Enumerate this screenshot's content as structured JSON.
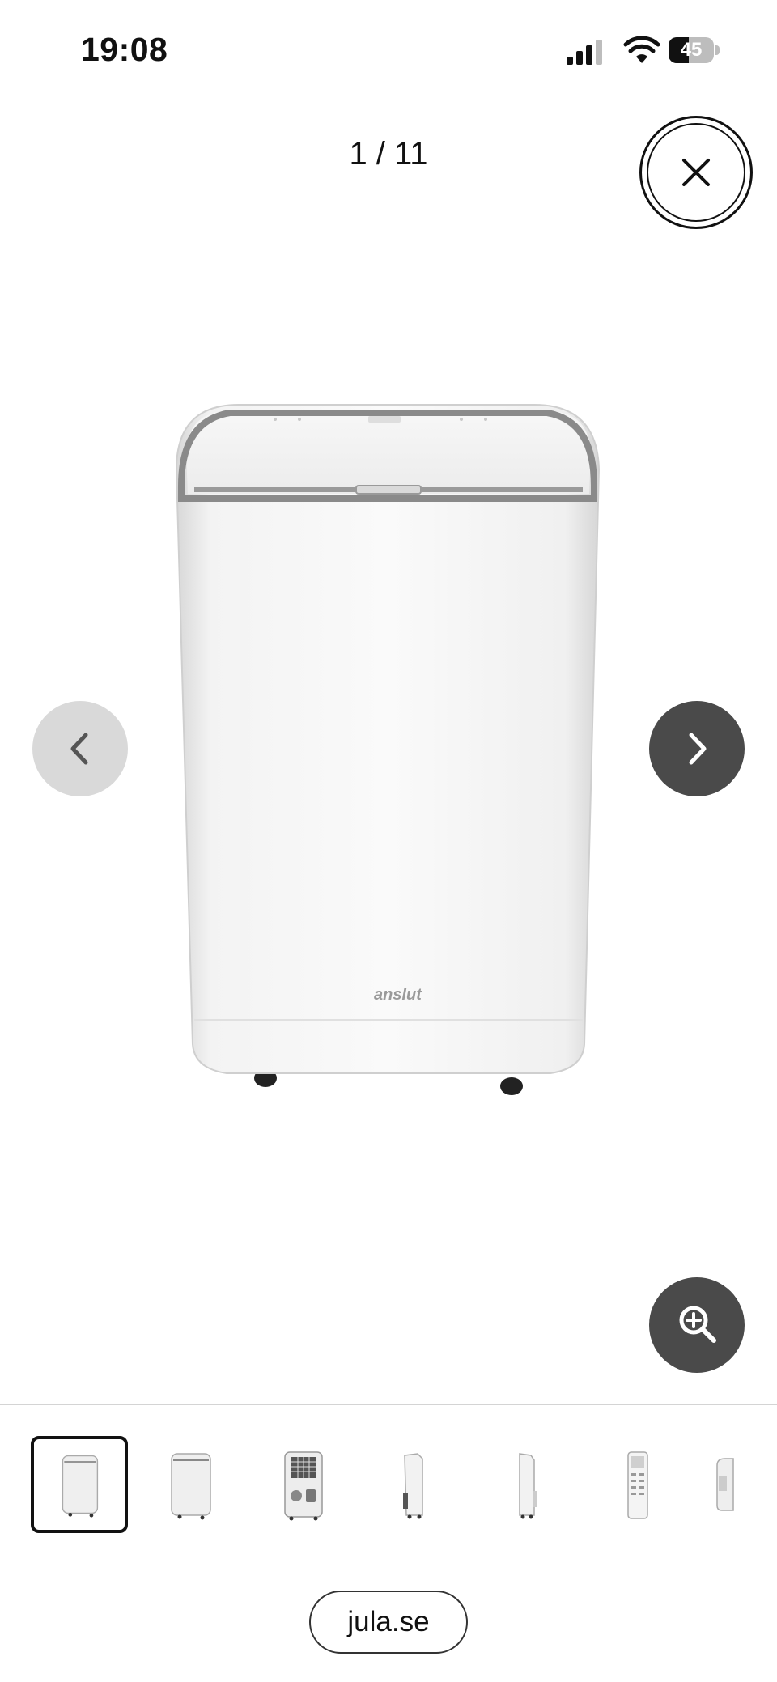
{
  "status_bar": {
    "time": "19:08",
    "battery_level": "45",
    "battery_percent": 45,
    "icons": [
      "cellular-signal-icon",
      "wifi-icon",
      "battery-icon"
    ]
  },
  "gallery": {
    "counter": "1 / 11",
    "current_index": 1,
    "total": 11,
    "main_image": {
      "description": "portable air conditioner",
      "logo_text": "anslut"
    },
    "thumbnails": [
      {
        "subject": "ac-front"
      },
      {
        "subject": "ac-front-angle"
      },
      {
        "subject": "ac-back"
      },
      {
        "subject": "ac-side"
      },
      {
        "subject": "ac-side-2"
      },
      {
        "subject": "remote-control"
      },
      {
        "subject": "detail-partial"
      }
    ],
    "buttons": {
      "close": "close-icon",
      "previous": "chevron-left-icon",
      "next": "chevron-right-icon",
      "zoom": "zoom-in-icon"
    }
  },
  "browser": {
    "url": "jula.se"
  },
  "colors": {
    "background": "#ffffff",
    "dark_button": "#4a4a4a",
    "light_button": "#d9d9d9",
    "text": "#111111"
  }
}
